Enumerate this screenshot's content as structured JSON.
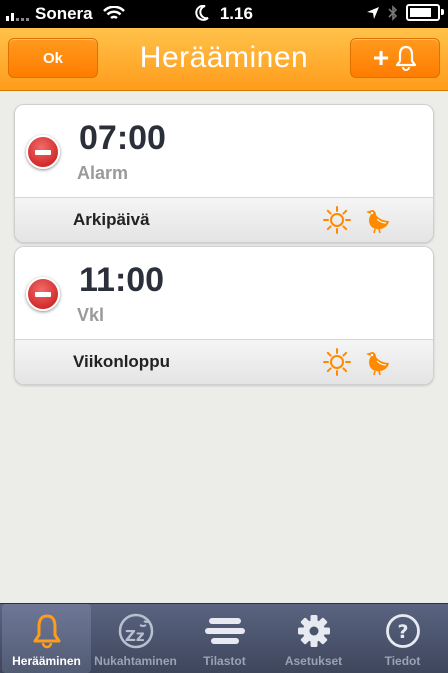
{
  "status_bar": {
    "carrier": "Sonera",
    "time": "1.16"
  },
  "nav": {
    "title": "Herääminen",
    "ok_label": "Ok"
  },
  "alarms": [
    {
      "time": "07:00",
      "name": "Alarm",
      "days": "Arkipäivä"
    },
    {
      "time": "11:00",
      "name": "Vkl",
      "days": "Viikonloppu"
    }
  ],
  "tabs": [
    {
      "label": "Herääminen",
      "icon": "bell-icon",
      "active": true
    },
    {
      "label": "Nukahtaminen",
      "icon": "sleep-zz-icon",
      "active": false
    },
    {
      "label": "Tilastot",
      "icon": "bars-icon",
      "active": false
    },
    {
      "label": "Asetukset",
      "icon": "gear-icon",
      "active": false
    },
    {
      "label": "Tiedot",
      "icon": "help-icon",
      "active": false
    }
  ],
  "colors": {
    "accent": "#ff9c1c",
    "delete": "#d12020",
    "tab_bar": "#4a536c"
  }
}
